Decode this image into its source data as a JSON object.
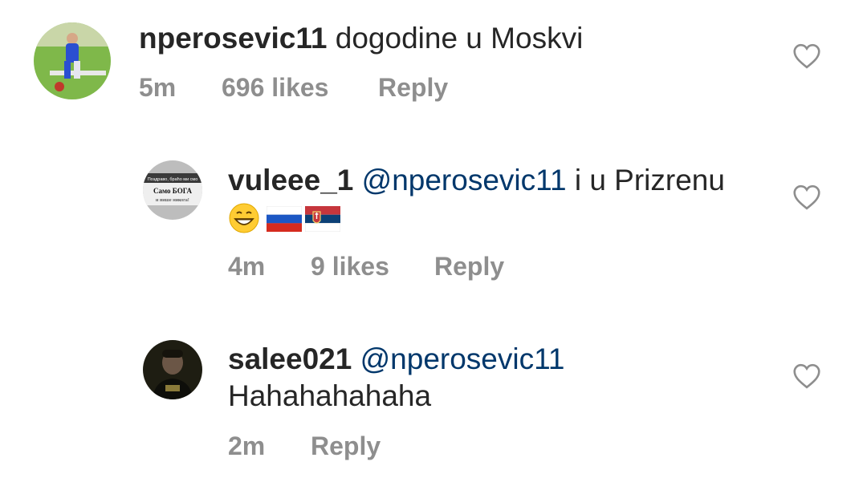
{
  "comments": [
    {
      "username": "nperosevic11",
      "text": "dogodine u Moskvi",
      "time": "5m",
      "likes": "696 likes",
      "reply": "Reply",
      "avatar_icon": "football-player-avatar"
    },
    {
      "username": "vuleee_1",
      "mention": "@nperosevic11",
      "text": "i u Prizrenu",
      "emojis": [
        "grinning-face-emoji",
        "russia-flag-emoji",
        "serbia-flag-emoji"
      ],
      "time": "4m",
      "likes": "9 likes",
      "reply": "Reply",
      "avatar_icon": "banner-avatar",
      "avatar_text": [
        "Поздраво, браћо ми смо",
        "Само БОГА",
        "и више никога!"
      ]
    },
    {
      "username": "salee021",
      "mention": "@nperosevic11",
      "text": "Hahahahahaha",
      "time": "2m",
      "reply": "Reply",
      "avatar_icon": "dark-portrait-avatar"
    }
  ],
  "colors": {
    "username": "#262626",
    "mention": "#00376b",
    "meta": "#8e8e8e",
    "heart": "#8e8e8e"
  }
}
